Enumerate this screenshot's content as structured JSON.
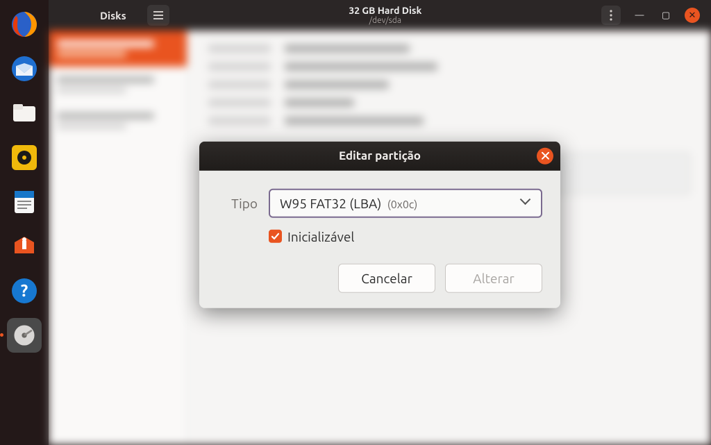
{
  "dock": {
    "items": [
      "firefox",
      "thunderbird",
      "files",
      "rhythmbox",
      "writer",
      "software",
      "help",
      "disks"
    ]
  },
  "window": {
    "app_name": "Disks",
    "title": "32 GB Hard Disk",
    "subtitle": "/dev/sda"
  },
  "dialog": {
    "title": "Editar partição",
    "type_label": "Tipo",
    "type_value": "W95 FAT32 (LBA)",
    "type_code": "(0x0c)",
    "bootable_label": "Inicializável",
    "bootable_checked": true,
    "cancel_label": "Cancelar",
    "apply_label": "Alterar"
  }
}
